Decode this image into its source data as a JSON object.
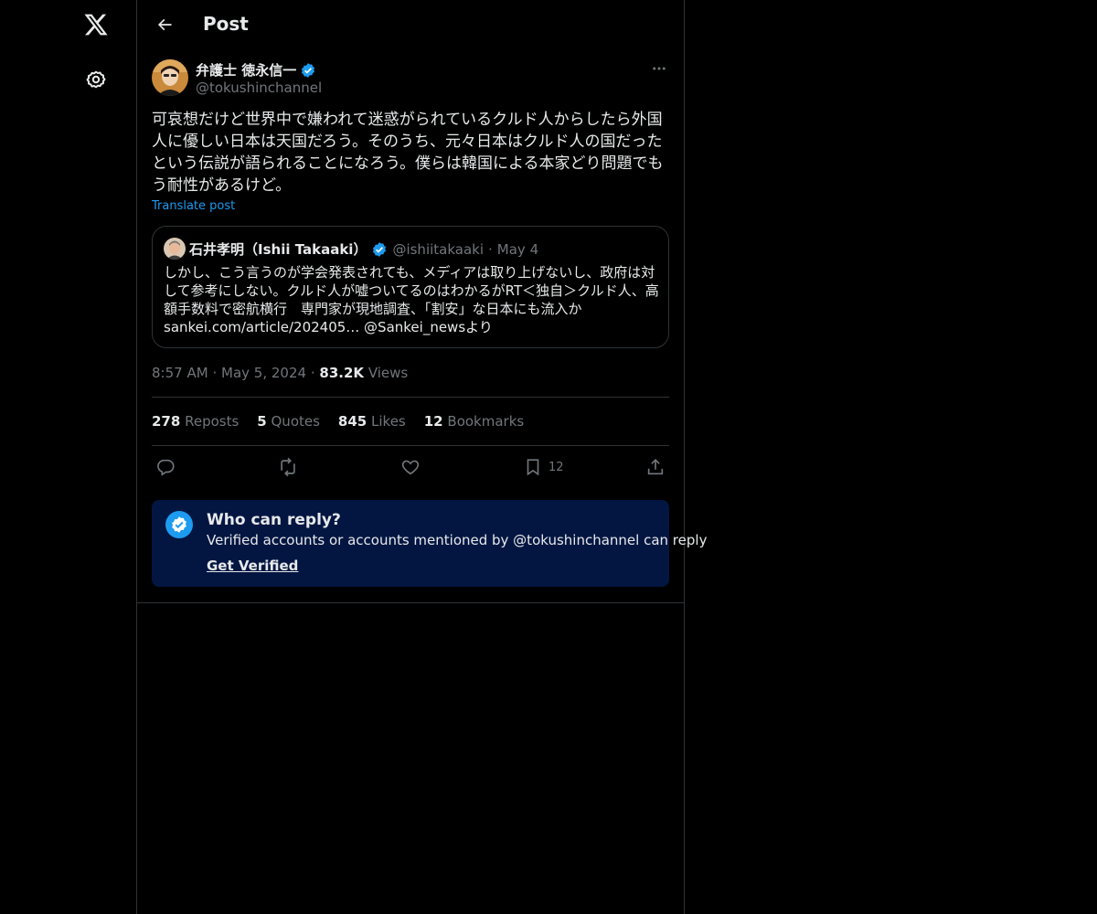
{
  "header": {
    "title": "Post"
  },
  "post": {
    "author_name": "弁護士 徳永信一",
    "author_handle": "@tokushinchannel",
    "text": "可哀想だけど世界中で嫌われて迷惑がられているクルド人からしたら外国人に優しい日本は天国だろう。そのうち、元々日本はクルド人の国だったという伝説が語られることになろう。僕らは韓国による本家どり問題でもう耐性があるけど。",
    "translate_label": "Translate post",
    "time": "8:57 AM",
    "date": "May 5, 2024",
    "views_count": "83.2K",
    "views_label": "Views",
    "sep": "·"
  },
  "quote": {
    "name": "石井孝明（Ishii Takaaki）",
    "handle": "@ishiitakaaki",
    "sep": "·",
    "date": "May 4",
    "text": "しかし、こう言うのが学会発表されても、メディアは取り上げないし、政府は対して参考にしない。クルド人が嘘ついてるのはわかるがRT＜独自＞クルド人、高額手数料で密航横行　専門家が現地調査、「割安」な日本にも流入か sankei.com/article/202405… @Sankei_newsより"
  },
  "stats": {
    "reposts_count": "278",
    "reposts_label": "Reposts",
    "quotes_count": "5",
    "quotes_label": "Quotes",
    "likes_count": "845",
    "likes_label": "Likes",
    "bookmarks_count": "12",
    "bookmarks_label": "Bookmarks"
  },
  "actions": {
    "bookmark_count": "12"
  },
  "reply_restriction": {
    "title": "Who can reply?",
    "description": "Verified accounts or accounts mentioned by @tokushinchannel can reply",
    "link": "Get Verified"
  },
  "icons": {
    "logo": "x-logo-icon",
    "settings": "gear-icon",
    "back": "arrow-left-icon",
    "more": "more-horizontal-icon",
    "verified": "verified-badge-icon",
    "reply": "reply-icon",
    "repost": "repost-icon",
    "like": "heart-icon",
    "bookmark": "bookmark-icon",
    "share": "share-icon"
  },
  "colors": {
    "accent": "#1d9bf0",
    "background": "#000000",
    "reply_box": "#031642",
    "muted": "#71767b"
  }
}
